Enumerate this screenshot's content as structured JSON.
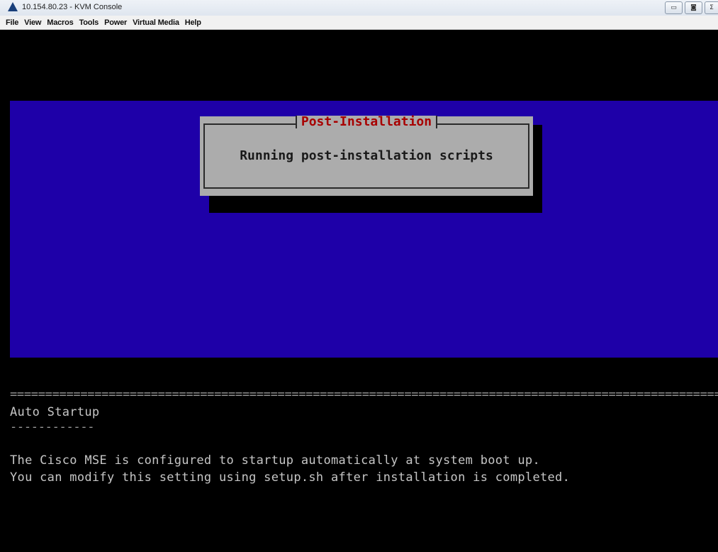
{
  "window": {
    "title": "10.154.80.23 - KVM Console",
    "controls": {
      "minimize": "▭",
      "maximize": "◙",
      "close": "Σ"
    }
  },
  "menu": [
    "File",
    "View",
    "Macros",
    "Tools",
    "Power",
    "Virtual Media",
    "Help"
  ],
  "dialog": {
    "title": "Post-Installation",
    "message": "Running post-installation scripts"
  },
  "terminal": {
    "separator": "============================================================================================================",
    "heading": "Auto Startup",
    "heading_underline": "------------",
    "lines": [
      "The Cisco MSE is configured to startup automatically at system boot up.",
      "You can modify this setting using setup.sh after installation is completed."
    ]
  },
  "colors": {
    "console_bg": "#000000",
    "dialog_area_blue": "#1e00a8",
    "dialog_bg": "#acacac",
    "dialog_title": "#a80000"
  }
}
